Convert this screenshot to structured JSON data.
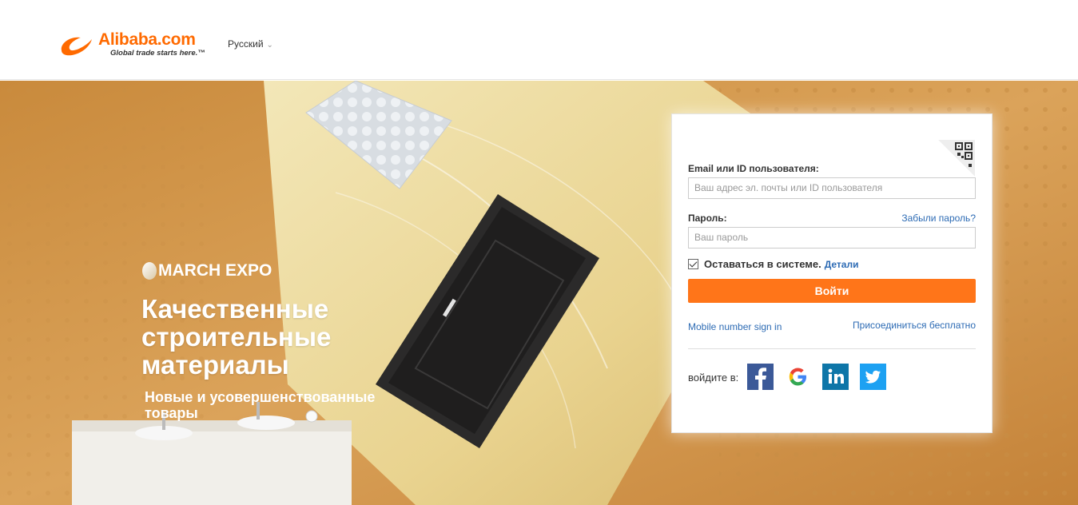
{
  "header": {
    "logo_text": "Alibaba.com",
    "logo_tagline": "Global trade starts here.™",
    "language": "Русский",
    "chevron_icon": "chevron-down-icon"
  },
  "hero": {
    "badge": "MARCH EXPO",
    "headline": "Качественные строительные материалы",
    "subheadline": "Новые и усовершенствованные товары",
    "background_color": "#d39a4a"
  },
  "login": {
    "qr_icon": "qr-code-icon",
    "email_label": "Email или ID пользователя:",
    "email_placeholder": "Ваш адрес эл. почты или ID пользователя",
    "email_value": "",
    "password_label": "Пароль:",
    "forgot_link": "Забыли пароль?",
    "password_placeholder": "Ваш пароль",
    "password_value": "",
    "remember_label": "Оставаться в системе.",
    "remember_checked": true,
    "details_link": "Детали",
    "submit_label": "Войти",
    "mobile_link": "Mobile number sign in",
    "join_link": "Присоединиться бесплатно",
    "social_label": "войдите в:",
    "social": [
      {
        "name": "facebook",
        "icon": "facebook-icon",
        "color": "#3b5998"
      },
      {
        "name": "google",
        "icon": "google-icon",
        "color": "#ffffff"
      },
      {
        "name": "linkedin",
        "icon": "linkedin-icon",
        "color": "#0e76a8"
      },
      {
        "name": "twitter",
        "icon": "twitter-icon",
        "color": "#1da1f2"
      }
    ],
    "accent_color": "#ff7519",
    "link_color": "#2d6bb4"
  }
}
